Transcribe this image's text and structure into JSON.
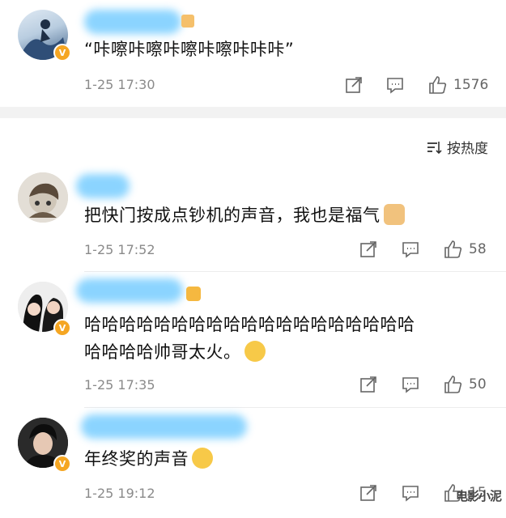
{
  "sort_label": "按热度",
  "watermark": "电影小泥",
  "comments": [
    {
      "text": "“咔嚓咔嚓咔嚓咔嚓咔咔咔”",
      "time": "1-25 17:30",
      "likes": "1576"
    },
    {
      "text": "把快门按成点钞机的声音，我也是福气",
      "time": "1-25 17:52",
      "likes": "58"
    },
    {
      "text_line1": "哈哈哈哈哈哈哈哈哈哈哈哈哈哈哈哈哈哈哈",
      "text_line2": "哈哈哈哈帅哥太火。",
      "time": "1-25 17:35",
      "likes": "50"
    },
    {
      "text": "年终奖的声音",
      "time": "1-25 19:12",
      "likes": "15"
    }
  ],
  "icons": {
    "share": "share-icon",
    "comment": "comment-icon",
    "like": "thumbs-up-icon",
    "sort": "sort-icon",
    "verified": "verified-badge-icon"
  },
  "colors": {
    "verified_badge": "#f5a623",
    "name_blur": "#7fd0ff"
  }
}
